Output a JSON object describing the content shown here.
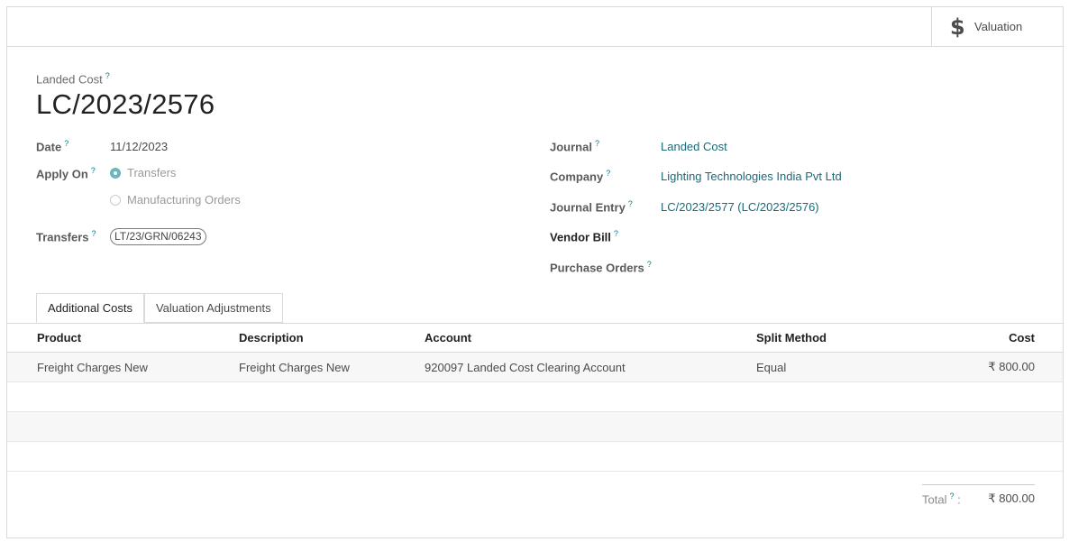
{
  "topbar": {
    "valuation_label": "Valuation",
    "valuation_icon": "$"
  },
  "header": {
    "record_type": "Landed Cost",
    "record_name": "LC/2023/2576",
    "help_mark": "?"
  },
  "left_fields": {
    "date_label": "Date",
    "date_value": "11/12/2023",
    "apply_on_label": "Apply On",
    "apply_options": [
      "Transfers",
      "Manufacturing Orders"
    ],
    "apply_selected": "Transfers",
    "transfers_label": "Transfers",
    "transfers_tag": "LT/23/GRN/06243"
  },
  "right_fields": {
    "journal_label": "Journal",
    "journal_value": "Landed Cost",
    "company_label": "Company",
    "company_value": "Lighting Technologies India Pvt Ltd",
    "journal_entry_label": "Journal Entry",
    "journal_entry_value": "LC/2023/2577 (LC/2023/2576)",
    "vendor_bill_label": "Vendor Bill",
    "purchase_orders_label": "Purchase Orders"
  },
  "tabs": [
    "Additional Costs",
    "Valuation Adjustments"
  ],
  "table": {
    "headers": [
      "Product",
      "Description",
      "Account",
      "Split Method",
      "Cost"
    ],
    "rows": [
      [
        "Freight Charges New",
        "Freight Charges New",
        "920097 Landed Cost Clearing Account",
        "Equal",
        "₹ 800.00"
      ]
    ]
  },
  "footer": {
    "total_label": "Total",
    "total_colon": ":",
    "total_value": "₹ 800.00"
  },
  "colors": {
    "link": "#1b6a7a",
    "accent": "#017e84",
    "radio_on": "#6cb7bc"
  }
}
